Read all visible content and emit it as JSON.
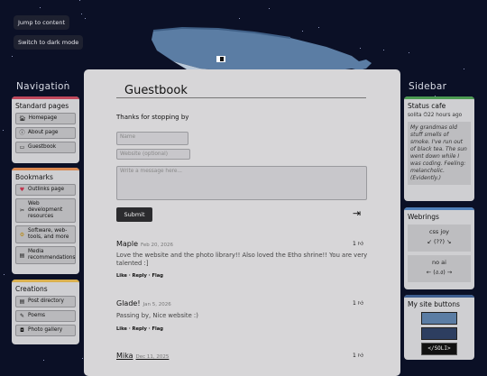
{
  "skip_links": {
    "jump": "Jump to content",
    "dark": "Switch to dark mode"
  },
  "left": {
    "title": "Navigation",
    "standard": {
      "title": "Standard pages",
      "color": "#c0485c",
      "items": [
        "Homepage",
        "About page",
        "Guestbook"
      ]
    },
    "bookmarks": {
      "title": "Bookmarks",
      "color": "#d9874f",
      "items": [
        "Outlinks page",
        "Web development resources",
        "Software, web-tools, and more",
        "Media recommendations"
      ]
    },
    "creations": {
      "title": "Creations",
      "color": "#d9b04f",
      "items": [
        "Post directory",
        "Poems",
        "Photo gallery"
      ]
    }
  },
  "right": {
    "title": "Sidebar",
    "status": {
      "title": "Status cafe",
      "color": "#4c9a52",
      "user": "solita",
      "time": "22 hours ago",
      "text": "My grandmas old stuff smells of smoke. I've run out of black tea. The sun went down while I was coding. Feeling: melancholic. (Evidently.)"
    },
    "webrings": {
      "title": "Webrings",
      "color": "#4f7fb8",
      "ring1": {
        "name": "css joy",
        "nav": "↙ (??) ↘"
      },
      "ring2": {
        "name": "no ai",
        "nav": "← (ง.ง) →"
      }
    },
    "buttons": {
      "title": "My site buttons",
      "color": "#3d5d8f",
      "code": "</SOLI>"
    }
  },
  "main": {
    "title": "Guestbook",
    "thanks": "Thanks for stopping by",
    "name_placeholder": "Name",
    "website_placeholder": "Website (optional)",
    "message_placeholder": "Write a message here...",
    "submit": "Submit",
    "entries": [
      {
        "name": "Maple",
        "date": "Feb 20, 2026",
        "likes": "1",
        "text": "Love the website and the photo library!! Also loved the Etho shrine!! You are very talented :]",
        "actions": "Like · Reply · Flag"
      },
      {
        "name": "Glade!",
        "date": "Jan 5, 2026",
        "likes": "1",
        "text": "Passing by, Nice website :)",
        "actions": "Like · Reply · Flag"
      },
      {
        "name": "Mika",
        "date": "Dec 11, 2025",
        "likes": "1",
        "text": "",
        "actions": ""
      }
    ]
  }
}
